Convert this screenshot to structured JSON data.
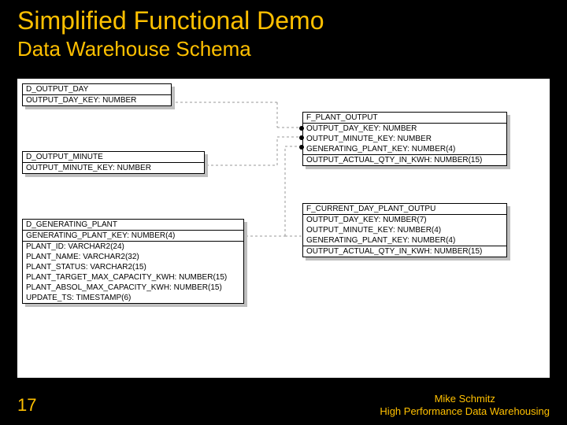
{
  "title": "Simplified Functional Demo",
  "subtitle": "Data Warehouse Schema",
  "page_number": "17",
  "credit_name": "Mike Schmitz",
  "credit_line2": "High Performance Data Warehousing",
  "tables": {
    "d_output_day": {
      "name": "D_OUTPUT_DAY",
      "pk": "OUTPUT_DAY_KEY: NUMBER"
    },
    "d_output_minute": {
      "name": "D_OUTPUT_MINUTE",
      "pk": "OUTPUT_MINUTE_KEY: NUMBER"
    },
    "d_generating_plant": {
      "name": "D_GENERATING_PLANT",
      "pk": "GENERATING_PLANT_KEY: NUMBER(4)",
      "c1": "PLANT_ID: VARCHAR2(24)",
      "c2": "PLANT_NAME: VARCHAR2(32)",
      "c3": "PLANT_STATUS: VARCHAR2(15)",
      "c4": "PLANT_TARGET_MAX_CAPACITY_KWH: NUMBER(15)",
      "c5": "PLANT_ABSOL_MAX_CAPACITY_KWH: NUMBER(15)",
      "c6": "UPDATE_TS: TIMESTAMP(6)"
    },
    "f_plant_output": {
      "name": "F_PLANT_OUTPUT",
      "c1": "OUTPUT_DAY_KEY: NUMBER",
      "c2": "OUTPUT_MINUTE_KEY: NUMBER",
      "c3": "GENERATING_PLANT_KEY: NUMBER(4)",
      "m1": "OUTPUT_ACTUAL_QTY_IN_KWH: NUMBER(15)"
    },
    "f_current_day_plant_output": {
      "name": "F_CURRENT_DAY_PLANT_OUTPU",
      "c1": "OUTPUT_DAY_KEY: NUMBER(7)",
      "c2": "OUTPUT_MINUTE_KEY: NUMBER(4)",
      "c3": "GENERATING_PLANT_KEY: NUMBER(4)",
      "m1": "OUTPUT_ACTUAL_QTY_IN_KWH: NUMBER(15)"
    }
  }
}
